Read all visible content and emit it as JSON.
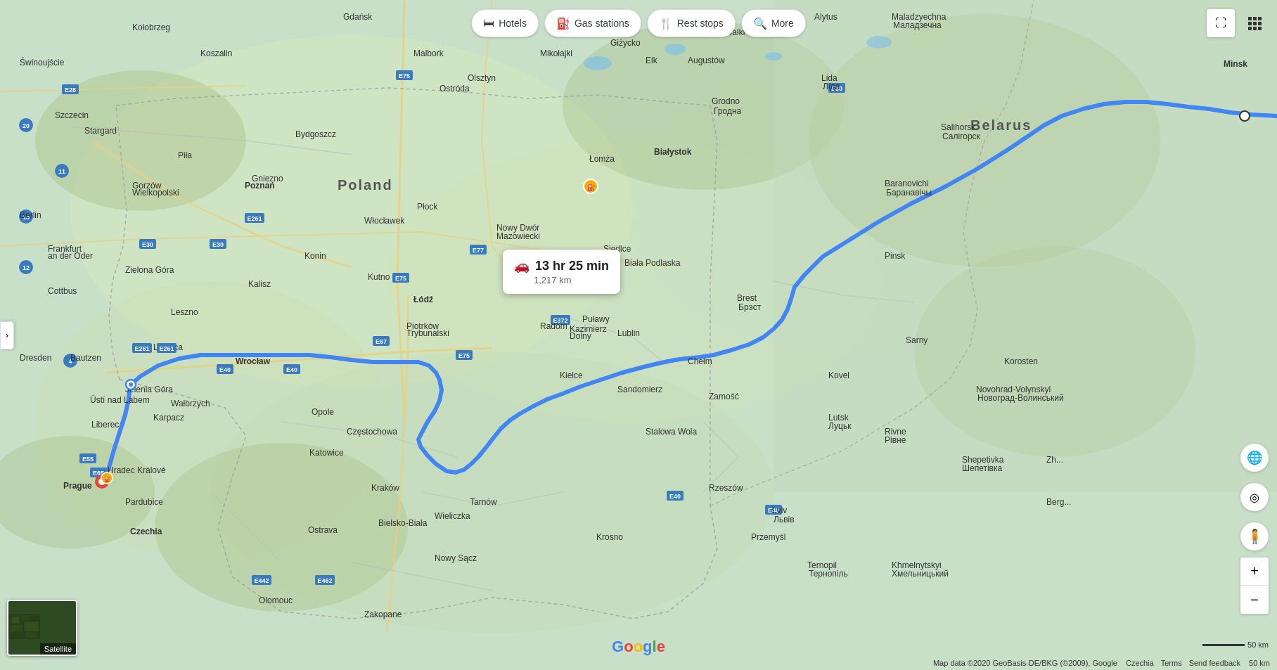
{
  "toolbar": {
    "hotels_label": "Hotels",
    "hotels_icon": "🛏",
    "gas_stations_label": "Gas stations",
    "gas_stations_icon": "⛽",
    "rest_stops_label": "Rest stops",
    "rest_stops_icon": "🍽",
    "more_label": "More",
    "more_icon": "🔍"
  },
  "route_popup": {
    "time": "13 hr 25 min",
    "distance": "1,217 km",
    "car_icon": "🚗"
  },
  "satellite_thumb": {
    "label": "Satellite"
  },
  "bottom_bar": {
    "map_data": "Map data ©2020 GeoBasis-DE/BKG (©2009), Google",
    "czechia": "Czechia",
    "terms": "Terms",
    "send_feedback": "Send feedback",
    "scale": "50 km"
  },
  "controls": {
    "zoom_in": "+",
    "zoom_out": "−",
    "fullscreen_icon": "⛶",
    "grid_icon": "⋮⋮",
    "pegman_color": "#F9AB00"
  }
}
